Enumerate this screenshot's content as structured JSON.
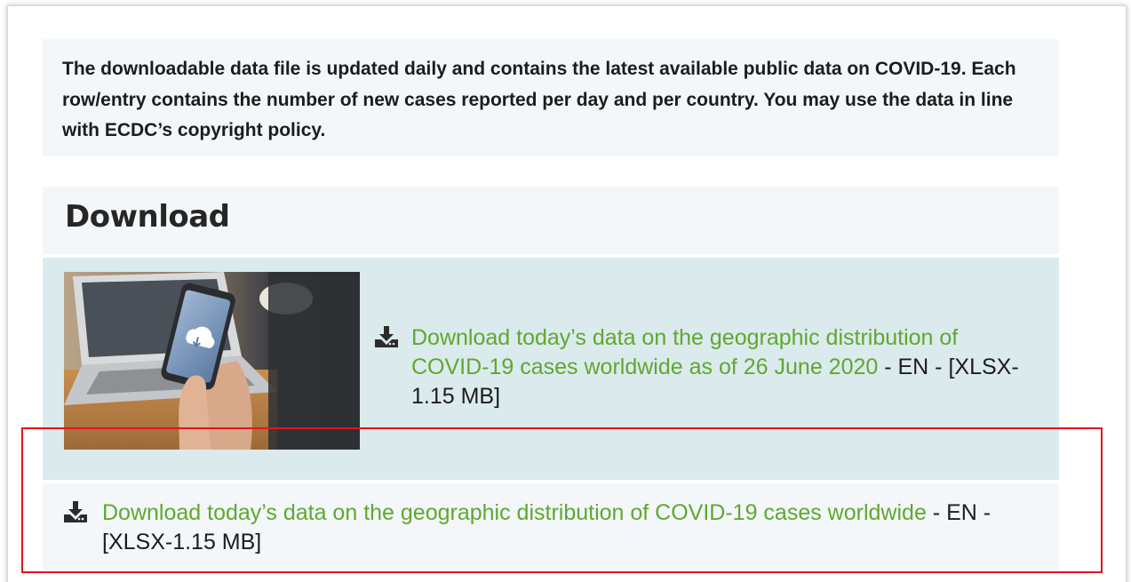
{
  "intro": {
    "text": "The downloadable data file is updated daily and contains the latest available public data on COVID-19. Each row/entry contains the number of new cases reported per day and per country. You may use the data in line with ECDC’s copyright policy."
  },
  "download_section": {
    "title": "Download",
    "items": [
      {
        "icon": "download-icon",
        "link_text": "Download today’s data on the geographic distribution of COVID-19 cases worldwide as of 26 June 2020",
        "suffix": " - EN - [XLSX-1.15 MB]",
        "thumbnail": "phone-cloud-download-image"
      },
      {
        "icon": "download-icon",
        "link_text": "Download today’s data on the geographic distribution of COVID-19 cases worldwide",
        "suffix": " - EN - [XLSX-1.15 MB]"
      }
    ]
  },
  "colors": {
    "link": "#5fa830",
    "panel_light": "#f3f7f9",
    "panel_teal": "#dbeaec",
    "highlight_border": "#e2141c",
    "text": "#1c1c1c"
  }
}
